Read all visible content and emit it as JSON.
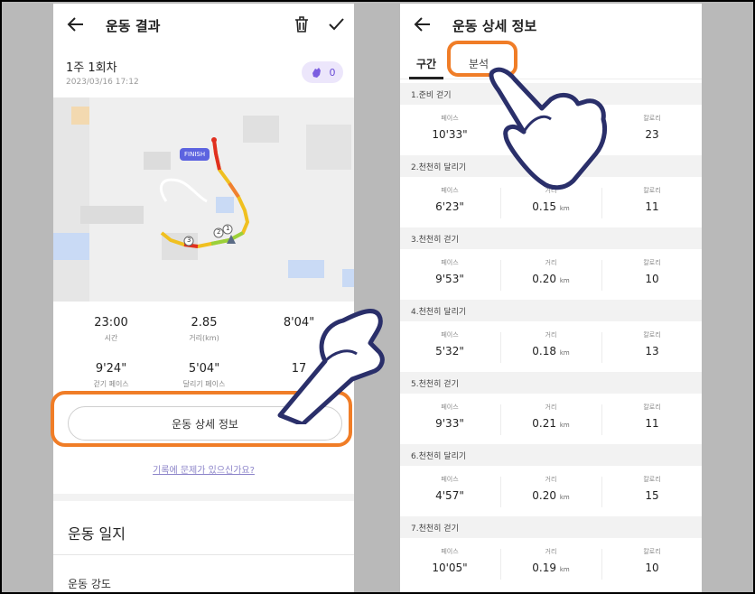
{
  "left": {
    "appbar": {
      "title": "운동 결과"
    },
    "session": {
      "title": "1주 1회차",
      "date": "2023/03/16 17:12",
      "clap_count": "0"
    },
    "map": {
      "finish_label": "FINISH",
      "markers": [
        "1",
        "2",
        "3"
      ]
    },
    "stats": [
      {
        "value": "23:00",
        "label": "시간"
      },
      {
        "value": "2.85",
        "label": "거리(km)"
      },
      {
        "value": "8'04\"",
        "label": ""
      },
      {
        "value": "9'24\"",
        "label": "걷기 페이스"
      },
      {
        "value": "5'04\"",
        "label": "달리기 페이스"
      },
      {
        "value": "17",
        "label": ""
      }
    ],
    "detail_button": "운동 상세 정보",
    "report_link": "기록에 문제가 있으신가요?",
    "journal_title": "운동 일지",
    "cut_text": "운동 강도"
  },
  "right": {
    "appbar": {
      "title": "운동 상세 정보"
    },
    "tabs": [
      "구간",
      "분석"
    ],
    "col_labels": {
      "pace": "페이스",
      "distance": "거리",
      "calorie": "칼로리"
    },
    "unit": "km",
    "segments": [
      {
        "name": "1.준비 걷기",
        "pace": "10'33\"",
        "distance": "",
        "calorie": "23"
      },
      {
        "name": "2.천천히 달리기",
        "pace": "6'23\"",
        "distance": "0.15",
        "calorie": "11"
      },
      {
        "name": "3.천천히 걷기",
        "pace": "9'53\"",
        "distance": "0.20",
        "calorie": "10"
      },
      {
        "name": "4.천천히 달리기",
        "pace": "5'32\"",
        "distance": "0.18",
        "calorie": "13"
      },
      {
        "name": "5.천천히 걷기",
        "pace": "9'33\"",
        "distance": "0.21",
        "calorie": "11"
      },
      {
        "name": "6.천천히 달리기",
        "pace": "4'57\"",
        "distance": "0.20",
        "calorie": "15"
      },
      {
        "name": "7.천천히 걷기",
        "pace": "10'05\"",
        "distance": "0.19",
        "calorie": "10"
      }
    ]
  },
  "colors": {
    "accent": "#f07d27",
    "brand": "#6a4cd6"
  },
  "icons": [
    "back-arrow-icon",
    "trash-icon",
    "check-icon",
    "clap-icon",
    "pointing-hand-icon"
  ]
}
